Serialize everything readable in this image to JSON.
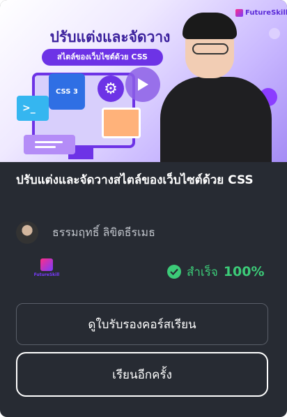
{
  "thumbnail": {
    "brand_text": "FutureSkill",
    "headline": "ปรับแต่งและจัดวาง",
    "subheadline": "สไตล์ของเว็บไซต์ด้วย CSS",
    "css_badge_text": "CSS 3",
    "icons": [
      "play-icon",
      "css3-icon",
      "gear-icon",
      "terminal-icon",
      "image-icon"
    ]
  },
  "course": {
    "title": "ปรับแต่งและจัดวางสไตล์ของเว็บไซต์ด้วย CSS",
    "instructor": "ธรรมฤทธิ์ ลิขิตธีรเมธ",
    "provider": "FutureSkill"
  },
  "status": {
    "label": "สำเร็จ",
    "percent": "100%",
    "color": "#3ccb78"
  },
  "buttons": {
    "certificate": "ดูใบรับรองคอร์สเรียน",
    "relearn": "เรียนอีกครั้ง"
  },
  "colors": {
    "card_bg": "#272b33",
    "brand_purple": "#6d33e6",
    "success_green": "#3ccb78"
  }
}
